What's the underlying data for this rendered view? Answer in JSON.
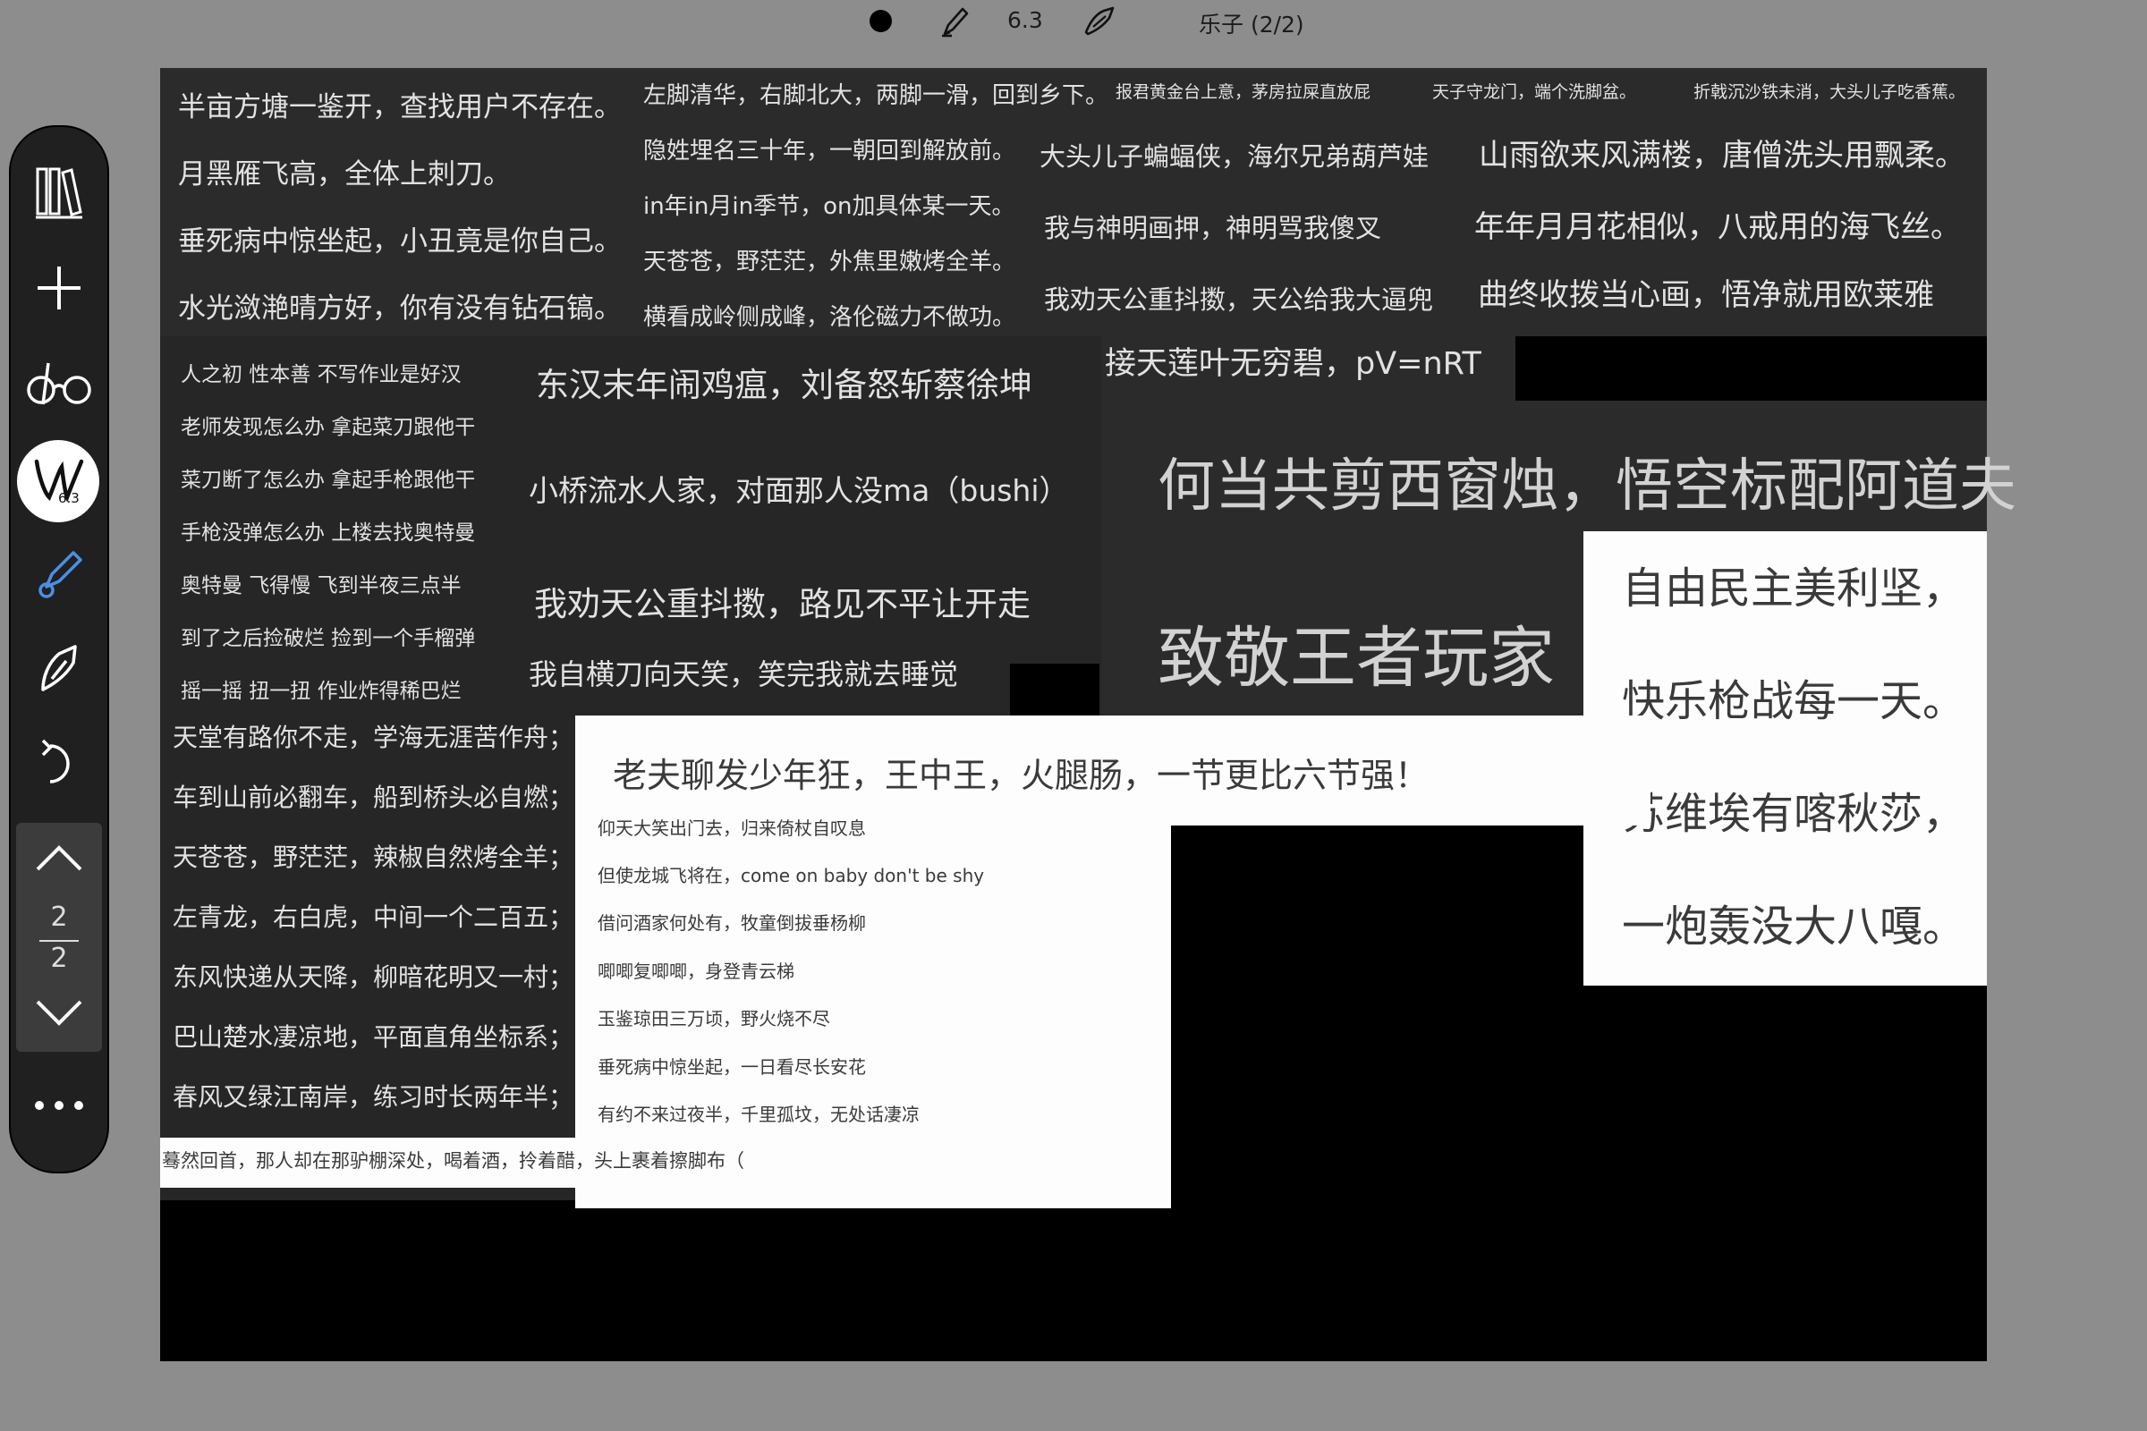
{
  "topbar": {
    "pen_size": "6.3",
    "page_title": "乐子 (2/2)"
  },
  "sidebar": {
    "badge_value": "6.3",
    "page_current": "2",
    "page_total": "2"
  },
  "canvas": {
    "col1": [
      "半亩方塘一鉴开，查找用户不存在。",
      "月黑雁飞高，全体上刺刀。",
      "垂死病中惊坐起，小丑竟是你自己。",
      "水光潋滟晴方好，你有没有钻石镐。"
    ],
    "col2": [
      "左脚清华，右脚北大，两脚一滑，回到乡下。",
      "隐姓埋名三十年，一朝回到解放前。",
      "in年in月in季节，on加具体某一天。",
      "天苍苍，野茫茫，外焦里嫩烤全羊。",
      "横看成岭侧成峰，洛伦磁力不做功。"
    ],
    "small_top": [
      "报君黄金台上意，茅房拉屎直放屁",
      "天子守龙门，端个洗脚盆。",
      "折戟沉沙铁未消，大头儿子吃香蕉。"
    ],
    "col3": [
      "大头儿子蝙蝠侠，海尔兄弟葫芦娃",
      "我与神明画押，神明骂我傻叉",
      "我劝天公重抖擞，天公给我大逼兜"
    ],
    "col4": [
      "山雨欲来风满楼，唐僧洗头用飘柔。",
      "年年月月花相似，八戒用的海飞丝。",
      "曲终收拨当心画，悟净就用欧莱雅"
    ],
    "lotus": "接天莲叶无穷碧，pV=nRT",
    "sanzijing": [
      "人之初 性本善 不写作业是好汉",
      "老师发现怎么办 拿起菜刀跟他干",
      "菜刀断了怎么办 拿起手枪跟他干",
      "手枪没弹怎么办 上楼去找奥特曼",
      "奥特曼 飞得慢 飞到半夜三点半",
      "到了之后捡破烂 捡到一个手榴弹",
      "摇一摇 扭一扭 作业炸得稀巴烂"
    ],
    "mid": [
      "东汉末年闹鸡瘟，刘备怒斩蔡徐坤",
      "小桥流水人家，对面那人没ma（bushi）",
      "我劝天公重抖擞，路见不平让开走",
      "我自横刀向天笑，笑完我就去睡觉"
    ],
    "big1": "何当共剪西窗烛，悟空标配阿道夫",
    "big2": "致敬王者玩家",
    "freedom": [
      "自由民主美利坚，",
      "快乐枪战每一天。",
      "苏维埃有喀秋莎，",
      "一炮轰没大八嘎。"
    ],
    "col_left_bottom": [
      "天堂有路你不走，学海无涯苦作舟；",
      "车到山前必翻车，船到桥头必自燃；",
      "天苍苍，野茫茫，辣椒自然烤全羊；",
      "左青龙，右白虎，中间一个二百五；",
      "东风快递从天降，柳暗花明又一村；",
      "巴山楚水凄凉地，平面直角坐标系；",
      "春风又绿江南岸，练习时长两年半；"
    ],
    "laofu": "老夫聊发少年狂，王中王，火腿肠，一节更比六节强！",
    "white_list": [
      "仰天大笑出门去，归来倚杖自叹息",
      "但使龙城飞将在，come on baby don't be shy",
      "借问酒家何处有，牧童倒拔垂杨柳",
      "唧唧复唧唧，身登青云梯",
      "玉鉴琼田三万顷，野火烧不尽",
      "垂死病中惊坐起，一日看尽长安花",
      "有约不来过夜半，千里孤坟，无处话凄凉"
    ],
    "bottom_strip": "蓦然回首，那人却在那驴棚深处，喝着酒，拎着醋，头上裹着擦脚布（"
  }
}
